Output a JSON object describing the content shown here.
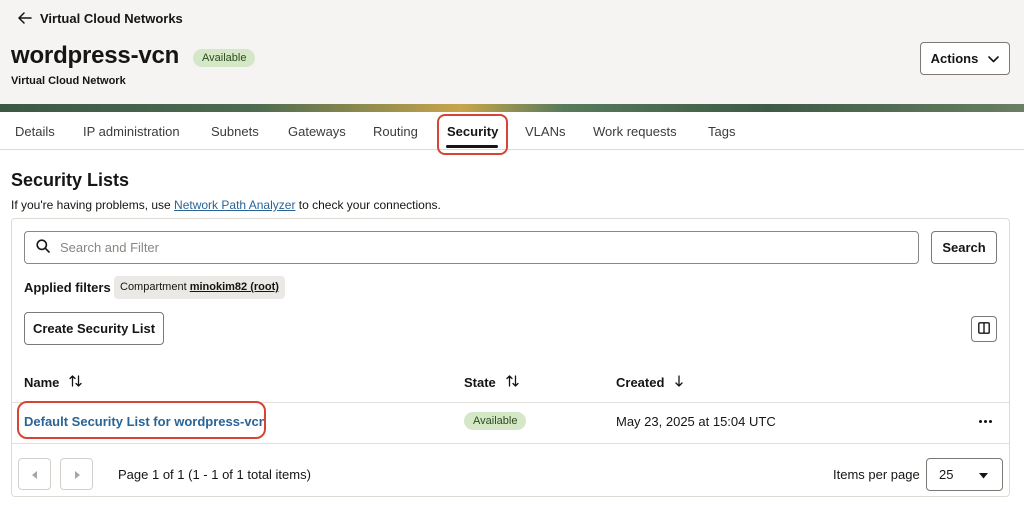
{
  "header": {
    "back_label": "Virtual Cloud Networks",
    "title": "wordpress-vcn",
    "status": "Available",
    "subtitle": "Virtual Cloud Network",
    "actions_label": "Actions"
  },
  "tabs": [
    {
      "label": "Details"
    },
    {
      "label": "IP administration"
    },
    {
      "label": "Subnets"
    },
    {
      "label": "Gateways"
    },
    {
      "label": "Routing"
    },
    {
      "label": "Security",
      "active": true
    },
    {
      "label": "VLANs"
    },
    {
      "label": "Work requests"
    },
    {
      "label": "Tags"
    }
  ],
  "section": {
    "title": "Security Lists",
    "help_prefix": "If you're having problems, use ",
    "help_link": "Network Path Analyzer",
    "help_suffix": " to check your connections."
  },
  "search": {
    "placeholder": "Search and Filter",
    "button_label": "Search"
  },
  "filters": {
    "label": "Applied filters",
    "chip_name": "Compartment",
    "chip_value": "minokim82 (root)"
  },
  "create_button_label": "Create Security List",
  "table": {
    "columns": [
      {
        "label": "Name",
        "sort": "both"
      },
      {
        "label": "State",
        "sort": "both"
      },
      {
        "label": "Created",
        "sort": "down"
      }
    ],
    "rows": [
      {
        "name": "Default Security List for wordpress-vcn",
        "state": "Available",
        "created": "May 23, 2025 at 15:04 UTC"
      }
    ]
  },
  "pagination": {
    "page_info": "Page 1 of 1 (1 - 1 of 1 total items)",
    "items_per_page_label": "Items per page",
    "items_per_page": "25"
  },
  "colors": {
    "link": "#2a6496",
    "badge_bg": "#d4e7c7",
    "highlight": "#d64534"
  }
}
